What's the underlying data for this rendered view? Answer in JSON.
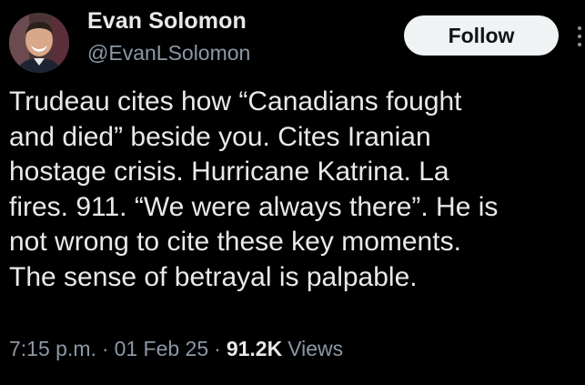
{
  "author": {
    "display_name": "Evan Solomon",
    "handle": "@EvanLSolomon",
    "avatar_icon": "profile-photo"
  },
  "follow_button": {
    "label": "Follow"
  },
  "more_menu": {
    "icon": "more-dots-icon"
  },
  "tweet": {
    "lines": [
      "Trudeau cites how “Canadians fought",
      "and died” beside you. Cites Iranian",
      "hostage crisis. Hurricane Katrina. La",
      "fires. 911. “We were always there”. He is",
      "not wrong to cite these key moments.",
      "The sense of betrayal is palpable."
    ]
  },
  "meta": {
    "time": "7:15 p.m.",
    "separator": "·",
    "date": "01 Feb 25",
    "views_count": "91.2K",
    "views_label": "Views"
  },
  "colors": {
    "background": "#000000",
    "primary_text": "#e7e9ea",
    "secondary_text": "#8b98a5",
    "button_bg": "#eff3f4",
    "button_text": "#0f1419"
  }
}
